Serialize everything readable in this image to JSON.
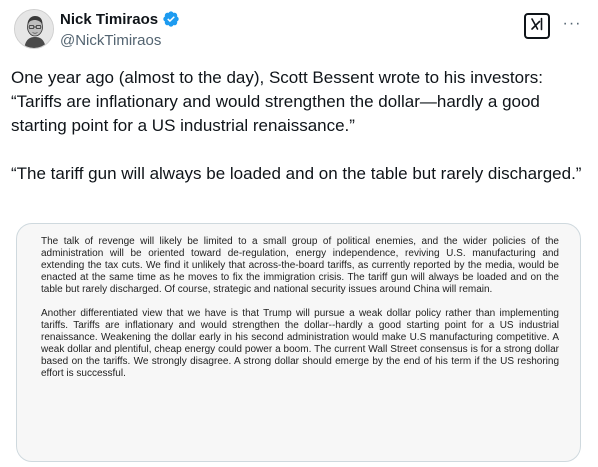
{
  "author": {
    "name": "Nick Timiraos",
    "handle": "@NickTimiraos",
    "verified_color": "#1d9bf0"
  },
  "actions": {
    "grok_icon": "grok-icon",
    "more_label": "···"
  },
  "tweet": {
    "paragraphs": [
      "One year ago (almost to the day), Scott Bessent wrote to his investors: “Tariffs are inflationary and would strengthen the dollar—hardly a good starting point for a US industrial renaissance.”",
      "“The tariff gun will always be loaded and on the table but rarely discharged.”"
    ]
  },
  "image": {
    "paragraphs": [
      "The talk of revenge will likely be limited to a small group of political enemies, and the wider policies of the administration will be oriented toward de-regulation, energy independence, reviving U.S. manufacturing and extending the tax cuts.  We find it unlikely that across-the-board tariffs, as currently reported by the media, would be enacted at the same time as he moves to fix the immigration crisis. The tariff gun will always be loaded and on the table but rarely discharged. Of course, strategic and national security issues around China will remain.",
      "Another differentiated view that we have is that Trump will pursue a weak dollar policy rather than implementing tariffs.  Tariffs are inflationary and would strengthen the dollar--hardly a good starting point for a US industrial renaissance.  Weakening the dollar early in his second administration would make U.S manufacturing competitive.  A weak dollar and plentiful, cheap energy could power a boom.  The current Wall Street consensus is for a strong dollar based on the tariffs.  We strongly disagree. A strong dollar should emerge by the end of his term if the US reshoring effort is successful."
    ]
  }
}
